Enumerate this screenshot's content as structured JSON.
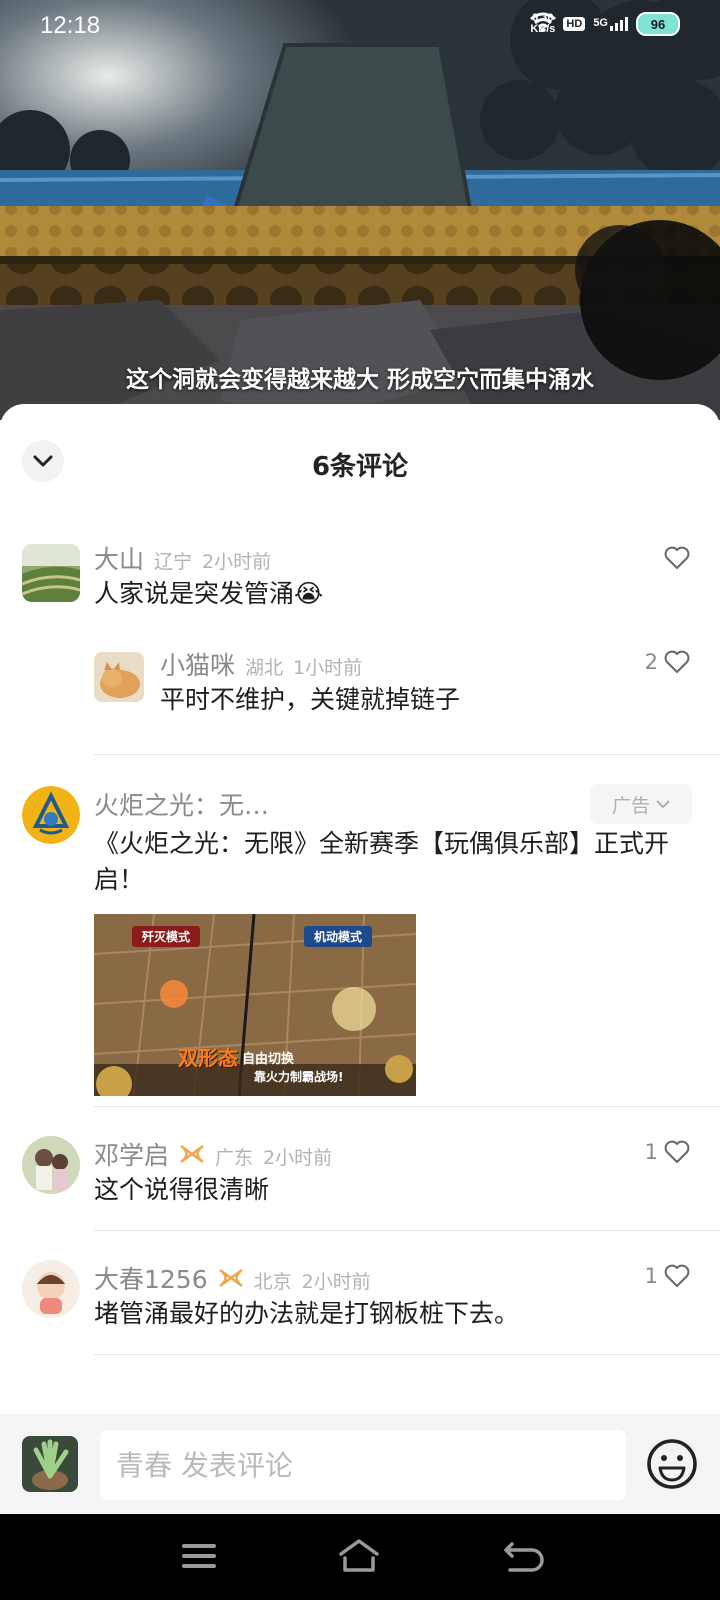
{
  "status_bar": {
    "time": "12:18",
    "net_speed_value": "0.30",
    "net_speed_unit": "KB/s",
    "hd": "HD",
    "network": "5G",
    "battery": "96"
  },
  "video": {
    "subtitle": "这个洞就会变得越来越大 形成空穴而集中涌水"
  },
  "comments_panel": {
    "title": "6条评论",
    "comments": [
      {
        "name": "大山",
        "location": "辽宁",
        "time": "2小时前",
        "text": "人家说是突发管涌😭",
        "likes": ""
      },
      {
        "name": "小猫咪",
        "location": "湖北",
        "time": "1小时前",
        "text": "平时不维护，关键就掉链子",
        "likes": "2"
      },
      {
        "name": "火炬之光：无…",
        "ad_label": "广告",
        "text": "《火炬之光：无限》全新赛季【玩偶俱乐部】正式开启！",
        "image": {
          "tag_left": "歼灭模式",
          "tag_right": "机动模式",
          "caption_main": "双形态",
          "caption_sub": "自由切换",
          "caption_bottom": "靠火力制霸战场!"
        }
      },
      {
        "name": "邓学启",
        "location": "广东",
        "time": "2小时前",
        "text": "这个说得很清晰",
        "likes": "1"
      },
      {
        "name": "大春1256",
        "location": "北京",
        "time": "2小时前",
        "text": "堵管涌最好的办法就是打钢板桩下去。",
        "likes": "1"
      }
    ]
  },
  "input_bar": {
    "placeholder": "青春 发表评论"
  },
  "colors": {
    "accent_badge": "#f0a64a",
    "battery": "#7fe3d4"
  },
  "icons": [
    "chevron-down-icon",
    "heart-icon",
    "fan-badge-icon",
    "emoji-icon",
    "menu-icon",
    "home-icon",
    "back-icon"
  ]
}
